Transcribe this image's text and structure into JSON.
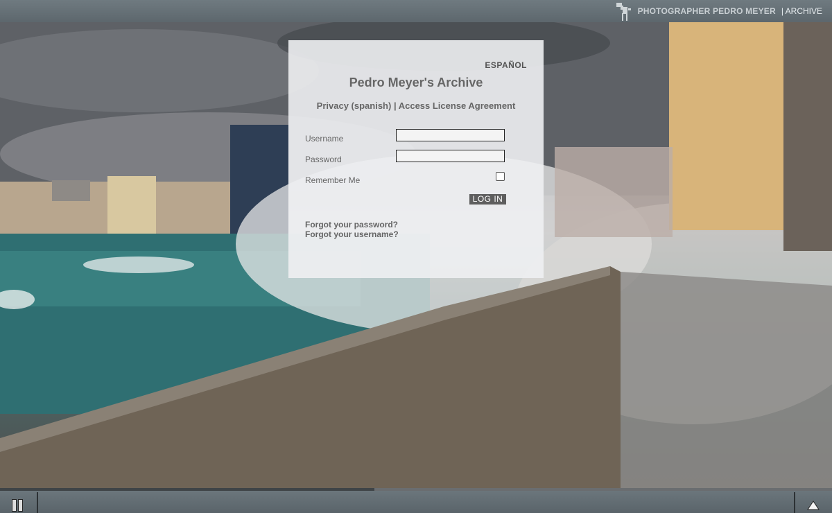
{
  "header": {
    "brand_name": "PHOTOGRAPHER PEDRO MEYER",
    "section": "| ARCHIVE",
    "logo_icon": "photographer-logo-icon"
  },
  "login": {
    "language_link": "ESPAÑOL",
    "title": "Pedro Meyer's Archive",
    "privacy_link": "Privacy (spanish)",
    "links_separator": " | ",
    "license_link": "Access License Agreement",
    "username_label": "Username",
    "username_value": "",
    "password_label": "Password",
    "password_value": "",
    "remember_label": "Remember Me",
    "remember_checked": false,
    "login_button": "LOG IN",
    "forgot_password": "Forgot your password?",
    "forgot_username": "Forgot your username?"
  },
  "slideshow": {
    "progress": 0.45,
    "pause_icon": "pause-icon",
    "expand_icon": "triangle-up-icon"
  },
  "colors": {
    "bar": "#5f6a70",
    "panel": "#eef0f2",
    "text": "#666666",
    "button": "#5e5e5e"
  }
}
